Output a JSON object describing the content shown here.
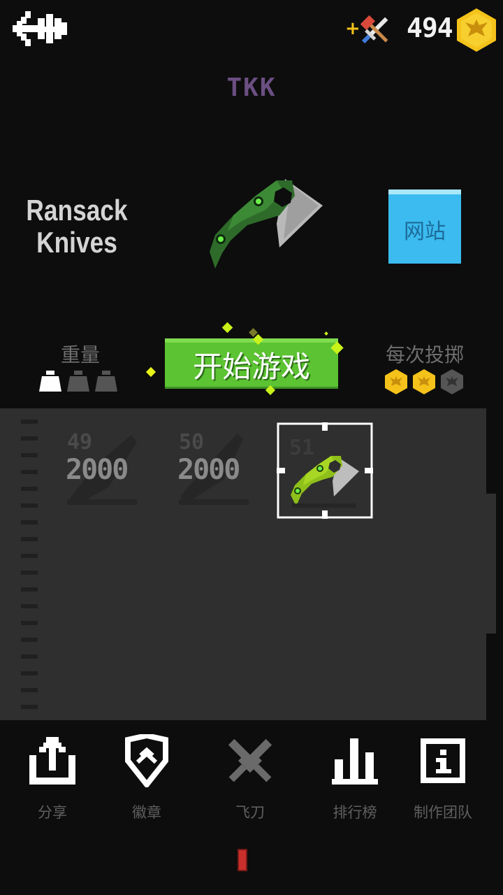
{
  "header": {
    "coins": "494",
    "plus_label": "+"
  },
  "brand": "TKK",
  "knife": {
    "name_line1": "Ransack",
    "name_line2": "Knives"
  },
  "website_label": "网站",
  "weight": {
    "label": "重量",
    "level": 1,
    "max": 3
  },
  "throw_cost": {
    "label": "每次投掷",
    "level": 2,
    "max": 3
  },
  "start_label": "开始游戏",
  "slots": [
    {
      "number": "49",
      "price": "2000",
      "locked": true
    },
    {
      "number": "50",
      "price": "2000",
      "locked": true
    },
    {
      "number": "51",
      "price": "",
      "locked": false,
      "selected": true
    }
  ],
  "nav": [
    {
      "label": "分享",
      "icon": "share-icon"
    },
    {
      "label": "徽章",
      "icon": "badge-icon"
    },
    {
      "label": "飞刀",
      "icon": "crossed-knives-icon"
    },
    {
      "label": "排行榜",
      "icon": "leaderboard-icon"
    },
    {
      "label": "制作团队",
      "icon": "info-icon"
    }
  ],
  "colors": {
    "accent_green": "#5cc332",
    "website_blue": "#3bbbef",
    "coin_gold": "#f4c21a",
    "brand_purple": "#6b4f82"
  }
}
